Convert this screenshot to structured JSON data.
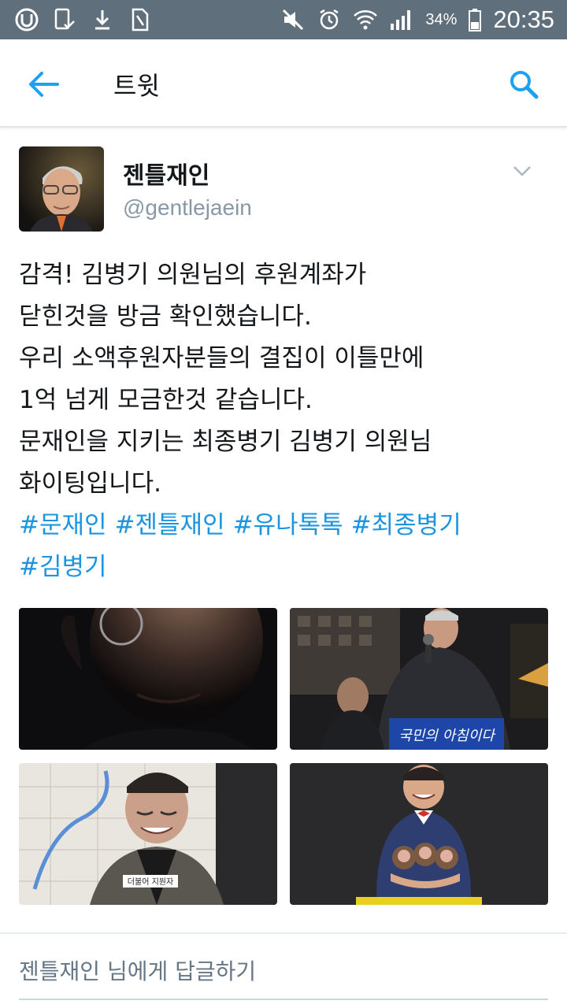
{
  "statusbar": {
    "battery": "34%",
    "time": "20:35",
    "icons_left": [
      "u-plus-icon",
      "phone-check-icon",
      "download-icon",
      "sim-card-icon"
    ],
    "icons_right": [
      "mute-icon",
      "alarm-icon",
      "wifi-icon",
      "signal-icon",
      "battery-icon"
    ]
  },
  "appbar": {
    "title": "트윗",
    "back_icon": "arrow-left-icon",
    "search_icon": "search-icon"
  },
  "tweet": {
    "author_name": "젠틀재인",
    "author_handle": "@gentlejaein",
    "lines": [
      "감격! 김병기 의원님의 후원계좌가",
      "닫힌것을 방금 확인했습니다.",
      "우리 소액후원자분들의 결집이 이틀만에",
      "1억 넘게 모금한것 같습니다.",
      "문재인을 지키는 최종병기 김병기 의원님",
      "화이팅입니다."
    ],
    "hashtags": [
      "#문재인",
      "#젠틀재인",
      "#유나톡톡",
      "#최종병기",
      "#김병기"
    ],
    "photo2_banner": "국민의 아침이다",
    "photo3_nametag": "더불어 지원자"
  },
  "reply": {
    "placeholder": "젠틀재인 님에게 답글하기"
  },
  "colors": {
    "statusbar": "#5f6f7c",
    "accent": "#1da1f2",
    "hashtag": "#1b95e0",
    "text": "#14171a",
    "muted": "#8899a6"
  }
}
